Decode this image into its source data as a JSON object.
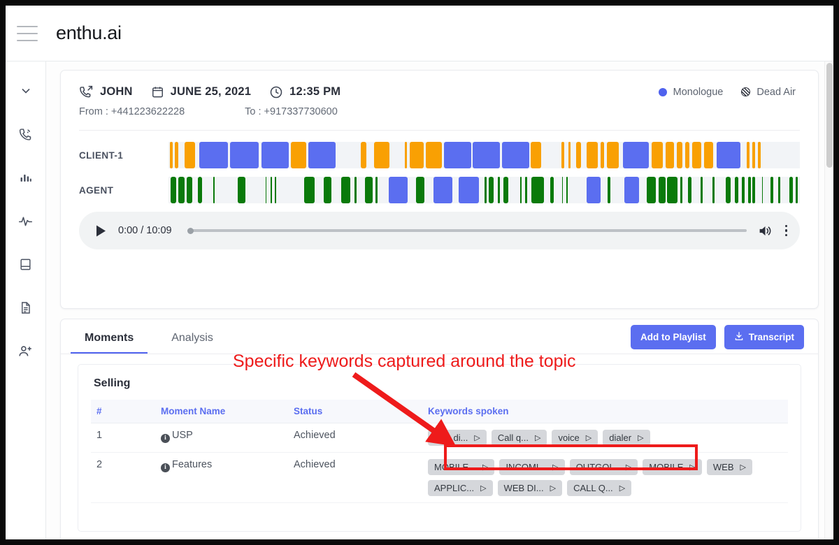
{
  "app": {
    "brand": "enthu.ai",
    "menu_icon": "hamburger-icon"
  },
  "sidebar": {
    "items": [
      {
        "icon": "chevron-down-icon",
        "name": "collapse"
      },
      {
        "icon": "phone-ringing-icon",
        "name": "calls"
      },
      {
        "icon": "bar-chart-icon",
        "name": "reports"
      },
      {
        "icon": "activity-pulse-icon",
        "name": "activity"
      },
      {
        "icon": "book-icon",
        "name": "library"
      },
      {
        "icon": "document-icon",
        "name": "documents"
      },
      {
        "icon": "add-person-icon",
        "name": "add-user"
      }
    ]
  },
  "call": {
    "agent_name": "JOHN",
    "date": "JUNE 25, 2021",
    "time": "12:35 PM",
    "from_label": "From : +441223622228",
    "to_label": "To : +917337730600",
    "legend": [
      {
        "label": "Monologue",
        "marker": "solid-dot",
        "color": "#4f62ee"
      },
      {
        "label": "Dead Air",
        "marker": "hatched-dot",
        "color": "#2b2f3a"
      }
    ],
    "tracks": [
      {
        "label": "CLIENT-1",
        "segments": [
          {
            "x": 0.2,
            "w": 0.5,
            "c": "#f9a003"
          },
          {
            "x": 1.0,
            "w": 0.5,
            "c": "#f9a003"
          },
          {
            "x": 2.6,
            "w": 1.6,
            "c": "#f9a003"
          },
          {
            "x": 4.9,
            "w": 4.5,
            "c": "#5b6ef0"
          },
          {
            "x": 9.8,
            "w": 4.5,
            "c": "#5b6ef0"
          },
          {
            "x": 14.7,
            "w": 4.3,
            "c": "#5b6ef0"
          },
          {
            "x": 19.4,
            "w": 2.4,
            "c": "#f9a003"
          },
          {
            "x": 22.2,
            "w": 4.3,
            "c": "#5b6ef0"
          },
          {
            "x": 30.4,
            "w": 0.9,
            "c": "#f9a003"
          },
          {
            "x": 32.6,
            "w": 2.4,
            "c": "#f9a003"
          },
          {
            "x": 37.4,
            "w": 0.4,
            "c": "#f9a003"
          },
          {
            "x": 38.2,
            "w": 2.2,
            "c": "#f9a003"
          },
          {
            "x": 40.7,
            "w": 2.6,
            "c": "#f9a003"
          },
          {
            "x": 43.6,
            "w": 4.3,
            "c": "#5b6ef0"
          },
          {
            "x": 48.2,
            "w": 4.3,
            "c": "#5b6ef0"
          },
          {
            "x": 52.8,
            "w": 4.3,
            "c": "#5b6ef0"
          },
          {
            "x": 57.4,
            "w": 1.6,
            "c": "#f9a003"
          },
          {
            "x": 62.2,
            "w": 0.5,
            "c": "#f9a003"
          },
          {
            "x": 63.3,
            "w": 0.4,
            "c": "#f9a003"
          },
          {
            "x": 64.6,
            "w": 0.7,
            "c": "#f9a003"
          },
          {
            "x": 66.2,
            "w": 1.8,
            "c": "#f9a003"
          },
          {
            "x": 68.4,
            "w": 0.6,
            "c": "#f9a003"
          },
          {
            "x": 69.4,
            "w": 1.9,
            "c": "#f9a003"
          },
          {
            "x": 72.0,
            "w": 4.1,
            "c": "#5b6ef0"
          },
          {
            "x": 76.5,
            "w": 1.8,
            "c": "#f9a003"
          },
          {
            "x": 78.7,
            "w": 1.4,
            "c": "#f9a003"
          },
          {
            "x": 80.5,
            "w": 0.9,
            "c": "#f9a003"
          },
          {
            "x": 81.8,
            "w": 0.7,
            "c": "#f9a003"
          },
          {
            "x": 83.0,
            "w": 1.4,
            "c": "#f9a003"
          },
          {
            "x": 84.8,
            "w": 1.5,
            "c": "#f9a003"
          },
          {
            "x": 86.8,
            "w": 3.8,
            "c": "#5b6ef0"
          },
          {
            "x": 91.6,
            "w": 0.4,
            "c": "#f9a003"
          },
          {
            "x": 92.5,
            "w": 0.4,
            "c": "#f9a003"
          },
          {
            "x": 93.4,
            "w": 0.4,
            "c": "#f9a003"
          }
        ]
      },
      {
        "label": "AGENT",
        "segments": [
          {
            "x": 0.3,
            "w": 0.9,
            "c": "#0a7a0a"
          },
          {
            "x": 1.5,
            "w": 1.1,
            "c": "#0a7a0a"
          },
          {
            "x": 2.9,
            "w": 0.9,
            "c": "#0a7a0a"
          },
          {
            "x": 4.7,
            "w": 0.6,
            "c": "#0a7a0a"
          },
          {
            "x": 7.1,
            "w": 0.2,
            "c": "#0a7a0a"
          },
          {
            "x": 11.0,
            "w": 1.2,
            "c": "#0a7a0a"
          },
          {
            "x": 15.4,
            "w": 0.15,
            "c": "#0a7a0a"
          },
          {
            "x": 16.2,
            "w": 0.2,
            "c": "#0a7a0a"
          },
          {
            "x": 16.8,
            "w": 0.2,
            "c": "#0a7a0a"
          },
          {
            "x": 21.5,
            "w": 1.7,
            "c": "#0a7a0a"
          },
          {
            "x": 24.6,
            "w": 1.2,
            "c": "#0a7a0a"
          },
          {
            "x": 27.3,
            "w": 1.5,
            "c": "#0a7a0a"
          },
          {
            "x": 29.5,
            "w": 0.25,
            "c": "#0a7a0a"
          },
          {
            "x": 31.1,
            "w": 1.2,
            "c": "#0a7a0a"
          },
          {
            "x": 32.8,
            "w": 0.3,
            "c": "#0a7a0a"
          },
          {
            "x": 34.9,
            "w": 3.0,
            "c": "#5b6ef0"
          },
          {
            "x": 39.2,
            "w": 1.3,
            "c": "#0a7a0a"
          },
          {
            "x": 42.0,
            "w": 3.0,
            "c": "#5b6ef0"
          },
          {
            "x": 46.0,
            "w": 3.2,
            "c": "#5b6ef0"
          },
          {
            "x": 50.0,
            "w": 0.4,
            "c": "#0a7a0a"
          },
          {
            "x": 50.7,
            "w": 0.8,
            "c": "#0a7a0a"
          },
          {
            "x": 52.2,
            "w": 0.25,
            "c": "#0a7a0a"
          },
          {
            "x": 53.1,
            "w": 0.7,
            "c": "#0a7a0a"
          },
          {
            "x": 55.7,
            "w": 0.2,
            "c": "#0a7a0a"
          },
          {
            "x": 56.5,
            "w": 0.3,
            "c": "#0a7a0a"
          },
          {
            "x": 57.5,
            "w": 2.0,
            "c": "#0a7a0a"
          },
          {
            "x": 60.5,
            "w": 0.5,
            "c": "#0a7a0a"
          },
          {
            "x": 62.3,
            "w": 0.15,
            "c": "#0a7a0a"
          },
          {
            "x": 63.0,
            "w": 0.2,
            "c": "#0a7a0a"
          },
          {
            "x": 66.2,
            "w": 2.2,
            "c": "#5b6ef0"
          },
          {
            "x": 69.6,
            "w": 0.35,
            "c": "#0a7a0a"
          },
          {
            "x": 72.2,
            "w": 2.3,
            "c": "#5b6ef0"
          },
          {
            "x": 75.8,
            "w": 1.4,
            "c": "#0a7a0a"
          },
          {
            "x": 77.6,
            "w": 1.1,
            "c": "#0a7a0a"
          },
          {
            "x": 79.0,
            "w": 1.6,
            "c": "#0a7a0a"
          },
          {
            "x": 81.1,
            "w": 0.3,
            "c": "#0a7a0a"
          },
          {
            "x": 82.3,
            "w": 0.5,
            "c": "#0a7a0a"
          },
          {
            "x": 84.3,
            "w": 0.35,
            "c": "#0a7a0a"
          },
          {
            "x": 86.2,
            "w": 0.3,
            "c": "#0a7a0a"
          },
          {
            "x": 88.3,
            "w": 0.7,
            "c": "#0a7a0a"
          },
          {
            "x": 89.7,
            "w": 0.6,
            "c": "#0a7a0a"
          },
          {
            "x": 90.8,
            "w": 0.5,
            "c": "#0a7a0a"
          },
          {
            "x": 91.8,
            "w": 0.4,
            "c": "#0a7a0a"
          },
          {
            "x": 92.5,
            "w": 0.45,
            "c": "#0a7a0a"
          },
          {
            "x": 94.0,
            "w": 0.15,
            "c": "#0a7a0a"
          },
          {
            "x": 95.3,
            "w": 0.5,
            "c": "#0a7a0a"
          },
          {
            "x": 96.6,
            "w": 0.3,
            "c": "#0a7a0a"
          },
          {
            "x": 98.3,
            "w": 0.6,
            "c": "#0a7a0a"
          },
          {
            "x": 99.3,
            "w": 0.4,
            "c": "#0a7a0a"
          }
        ]
      }
    ]
  },
  "player": {
    "play_label": "play",
    "time_display": "0:00 / 10:09",
    "current_time": "0:00",
    "duration": "10:09",
    "progress_percent": 0,
    "volume_icon": "volume-icon",
    "menu_icon": "kebab-menu-icon"
  },
  "moments": {
    "tabs": [
      {
        "label": "Moments",
        "active": true
      },
      {
        "label": "Analysis",
        "active": false
      }
    ],
    "actions": [
      {
        "label": "Add to Playlist",
        "icon": "",
        "name": "add-to-playlist"
      },
      {
        "label": "Transcript",
        "icon": "download-icon",
        "name": "transcript"
      }
    ],
    "group_title": "Selling",
    "columns": [
      "#",
      "Moment Name",
      "Status",
      "Keywords spoken"
    ],
    "rows": [
      {
        "num": "1",
        "name": "USP",
        "status": "Achieved",
        "keywords": [
          "web di...",
          "Call q...",
          "voice",
          "dialer"
        ]
      },
      {
        "num": "2",
        "name": "Features",
        "status": "Achieved",
        "keywords": [
          "MOBILE...",
          "INCOMI...",
          "OUTGOI...",
          "MOBILE",
          "WEB",
          "APPLIC...",
          "WEB DI...",
          "CALL Q..."
        ]
      }
    ]
  },
  "annotation": {
    "text": "Specific keywords captured around the topic",
    "color": "#ee1b1b"
  }
}
